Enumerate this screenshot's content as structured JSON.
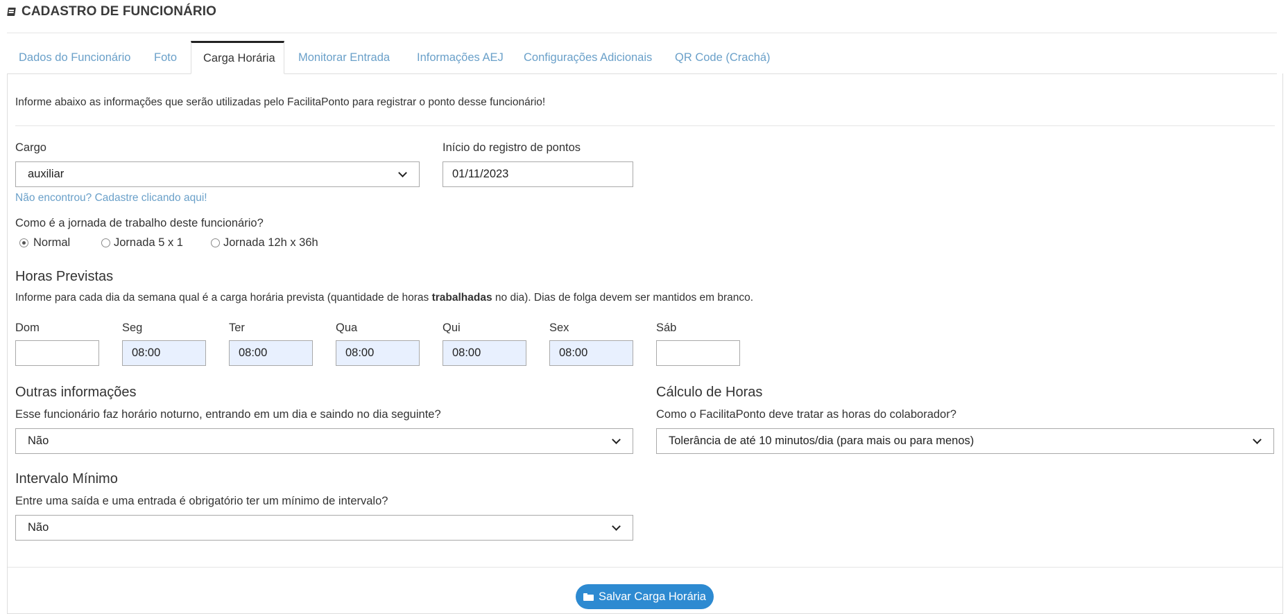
{
  "page": {
    "title": "CADASTRO DE FUNCIONÁRIO"
  },
  "tabs": [
    {
      "label": "Dados do Funcionário"
    },
    {
      "label": "Foto"
    },
    {
      "label": "Carga Horária"
    },
    {
      "label": "Monitorar Entrada"
    },
    {
      "label": "Informações AEJ"
    },
    {
      "label": "Configurações Adicionais"
    },
    {
      "label": "QR Code (Crachá)"
    }
  ],
  "active_tab": "Carga Horária",
  "intro": "Informe abaixo as informações que serão utilizadas pelo FacilitaPonto para registrar o ponto desse funcionário!",
  "cargo": {
    "label": "Cargo",
    "value": "auxiliar",
    "help_link": "Não encontrou? Cadastre clicando aqui!"
  },
  "inicio": {
    "label": "Início do registro de pontos",
    "value": "01/11/2023"
  },
  "jornada": {
    "question": "Como é a jornada de trabalho deste funcionário?",
    "options": [
      "Normal",
      "Jornada 5 x 1",
      "Jornada 12h x 36h"
    ],
    "selected": "Normal"
  },
  "horas_previstas": {
    "title": "Horas Previstas",
    "desc_before": "Informe para cada dia da semana qual é a carga horária prevista (quantidade de horas ",
    "desc_bold": "trabalhadas",
    "desc_after": " no dia). Dias de folga devem ser mantidos em branco.",
    "days": [
      {
        "label": "Dom",
        "value": ""
      },
      {
        "label": "Seg",
        "value": "08:00"
      },
      {
        "label": "Ter",
        "value": "08:00"
      },
      {
        "label": "Qua",
        "value": "08:00"
      },
      {
        "label": "Qui",
        "value": "08:00"
      },
      {
        "label": "Sex",
        "value": "08:00"
      },
      {
        "label": "Sáb",
        "value": ""
      }
    ]
  },
  "outras": {
    "title": "Outras informações",
    "question": "Esse funcionário faz horário noturno, entrando em um dia e saindo no dia seguinte?",
    "value": "Não"
  },
  "calculo": {
    "title": "Cálculo de Horas",
    "question": "Como o FacilitaPonto deve tratar as horas do colaborador?",
    "value": "Tolerância de até 10 minutos/dia (para mais ou para menos)"
  },
  "intervalo": {
    "title": "Intervalo Mínimo",
    "question": "Entre uma saída e uma entrada é obrigatório ter um mínimo de intervalo?",
    "value": "Não"
  },
  "save_button": {
    "label": "Salvar Carga Horária",
    "color": "#2d8ad1"
  },
  "icons": {
    "title_icon": "book-icon",
    "save_icon": "folder-open-icon"
  },
  "colors": {
    "link": "#6aa0c9",
    "autofill": "#e8f0fe"
  }
}
